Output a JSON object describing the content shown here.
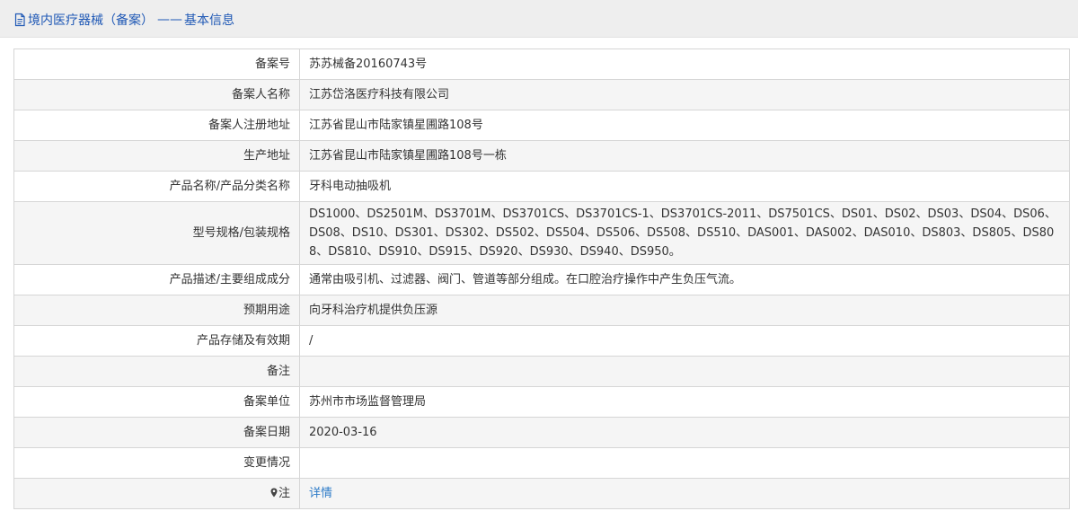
{
  "header": {
    "title_prefix": "境内医疗器械（备案）",
    "separator": "——",
    "title_suffix": "基本信息",
    "accent_color": "#1f58b5",
    "icon": "document-icon"
  },
  "rows": [
    {
      "label": "备案号",
      "value": "苏苏械备20160743号"
    },
    {
      "label": "备案人名称",
      "value": "江苏岱洛医疗科技有限公司"
    },
    {
      "label": "备案人注册地址",
      "value": "江苏省昆山市陆家镇星圃路108号"
    },
    {
      "label": "生产地址",
      "value": "江苏省昆山市陆家镇星圃路108号一栋"
    },
    {
      "label": "产品名称/产品分类名称",
      "value": "牙科电动抽吸机"
    },
    {
      "label": "型号规格/包装规格",
      "value": "DS1000、DS2501M、DS3701M、DS3701CS、DS3701CS-1、DS3701CS-2011、DS7501CS、DS01、DS02、DS03、DS04、DS06、DS08、DS10、DS301、DS302、DS502、DS504、DS506、DS508、DS510、DAS001、DAS002、DAS010、DS803、DS805、DS808、DS810、DS910、DS915、DS920、DS930、DS940、DS950。"
    },
    {
      "label": "产品描述/主要组成成分",
      "value": "通常由吸引机、过滤器、阀门、管道等部分组成。在口腔治疗操作中产生负压气流。"
    },
    {
      "label": "预期用途",
      "value": "向牙科治疗机提供负压源"
    },
    {
      "label": "产品存储及有效期",
      "value": "/"
    },
    {
      "label": "备注",
      "value": ""
    },
    {
      "label": "备案单位",
      "value": "苏州市市场监督管理局"
    },
    {
      "label": "备案日期",
      "value": "2020-03-16"
    },
    {
      "label": "变更情况",
      "value": ""
    },
    {
      "label": "注",
      "value": "详情",
      "icon": "location-pin-icon",
      "link_color": "#2d7bc8"
    }
  ]
}
